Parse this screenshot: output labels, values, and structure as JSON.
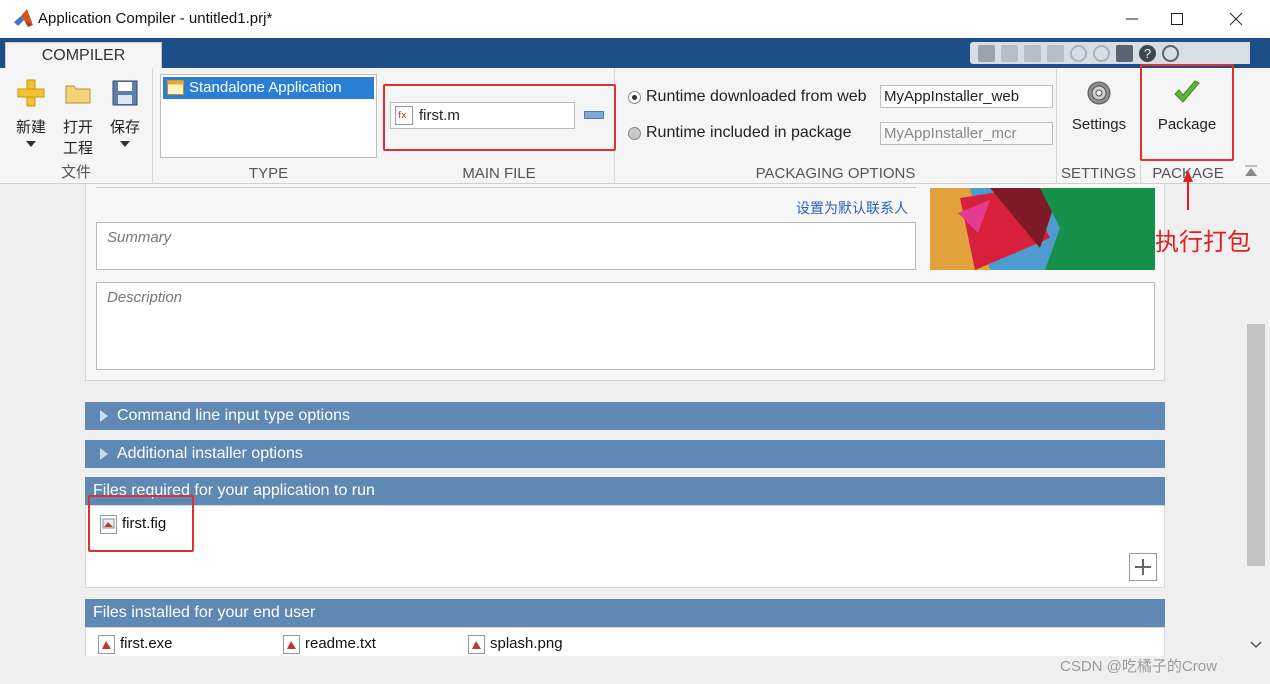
{
  "window": {
    "title": "Application Compiler - untitled1.prj*"
  },
  "ribbon_tab": "COMPILER",
  "file_section": {
    "label": "文件",
    "new_label": "新建",
    "open_label_1": "打开",
    "open_label_2": "工程",
    "save_label": "保存"
  },
  "type_section": {
    "label": "TYPE",
    "selected_item": "Standalone Application"
  },
  "main_file_section": {
    "label": "MAIN FILE",
    "file": "first.m"
  },
  "packaging_options": {
    "label": "PACKAGING OPTIONS",
    "option_web": "Runtime downloaded from web",
    "option_web_value": "MyAppInstaller_web",
    "option_pkg": "Runtime included in package",
    "option_pkg_value": "MyAppInstaller_mcr",
    "selected": "web"
  },
  "settings_section": {
    "label": "SETTINGS",
    "button": "Settings"
  },
  "package_section": {
    "label": "PACKAGE",
    "button": "Package"
  },
  "content": {
    "default_contact_link": "设置为默认联系人",
    "summary_placeholder": "Summary",
    "description_placeholder": "Description",
    "command_line_bar": "Command line input type options",
    "installer_bar": "Additional installer options",
    "files_required_bar": "Files required for your application to run",
    "files_required": [
      "first.fig"
    ],
    "files_installed_bar": "Files installed for your end user",
    "files_installed": [
      "first.exe",
      "readme.txt",
      "splash.png"
    ]
  },
  "annotation": "执行打包",
  "watermark": "CSDN @吃橘子的Crow",
  "colors": {
    "ribbon_blue": "#1e4e87",
    "bar_blue": "#5f88b5",
    "highlight_red": "#e03030",
    "selection_blue": "#2a7fd4"
  }
}
